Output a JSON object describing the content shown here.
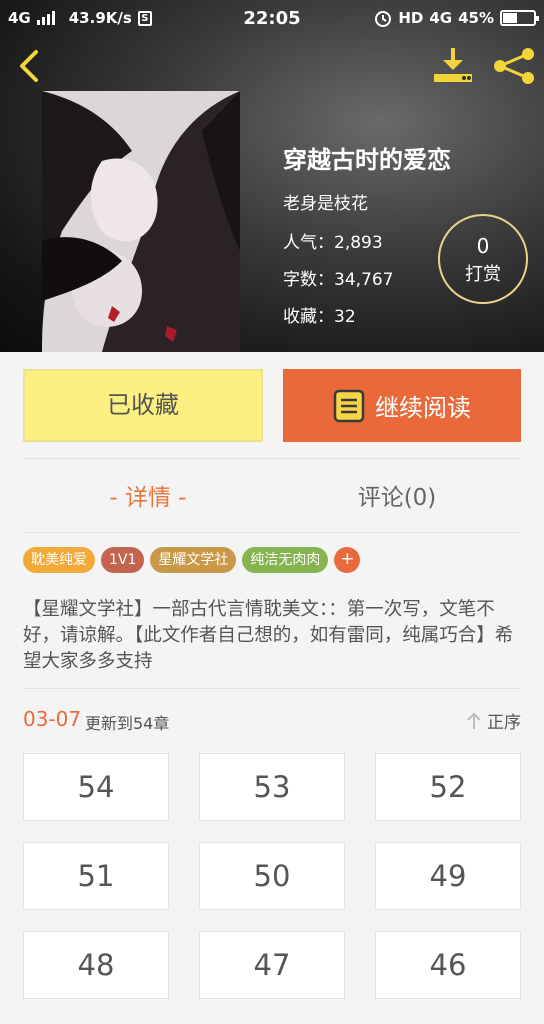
{
  "status_bar": {
    "network_left": "4G",
    "speed": "43.9K/s",
    "s_badge": "S",
    "time": "22:05",
    "hd": "HD",
    "network_right": "4G",
    "battery": "45%",
    "battery_level": 0.45
  },
  "icons": {
    "back": "back-arrow-icon",
    "download": "download-icon",
    "share": "share-icon",
    "book": "book-icon",
    "sort": "arrow-up-icon"
  },
  "book": {
    "title": "穿越古时的爱恋",
    "author": "老身是枝花",
    "popularity": "人气：2,893",
    "word_count": "字数：34,767",
    "favorites": "收藏：32"
  },
  "tip": {
    "count": "0",
    "label": "打赏"
  },
  "actions": {
    "collected": "已收藏",
    "continue_reading": "继续阅读"
  },
  "tabs": {
    "details": "- 详情 -",
    "comments": "评论(0)"
  },
  "tags": [
    {
      "label": "耽美纯爱",
      "color": "#f1a93a"
    },
    {
      "label": "1V1",
      "color": "#c4634e"
    },
    {
      "label": "星耀文学社",
      "color": "#c9994a"
    },
    {
      "label": "纯洁无肉肉",
      "color": "#86b451"
    }
  ],
  "tag_more": "+",
  "description": "【星耀文学社】一部古代言情耽美文：：第一次写，文笔不好，请谅解。【此文作者自己想的，如有雷同，纯属巧合】希望大家多多支持",
  "update": {
    "date": "03-07",
    "text": "更新到54章",
    "sort_label": "正序"
  },
  "chapters": [
    "54",
    "53",
    "52",
    "51",
    "50",
    "49",
    "48",
    "47",
    "46"
  ],
  "colors": {
    "accent": "#e9693b",
    "collected_bg": "#fbf081",
    "tip_border": "#e9d38a"
  }
}
